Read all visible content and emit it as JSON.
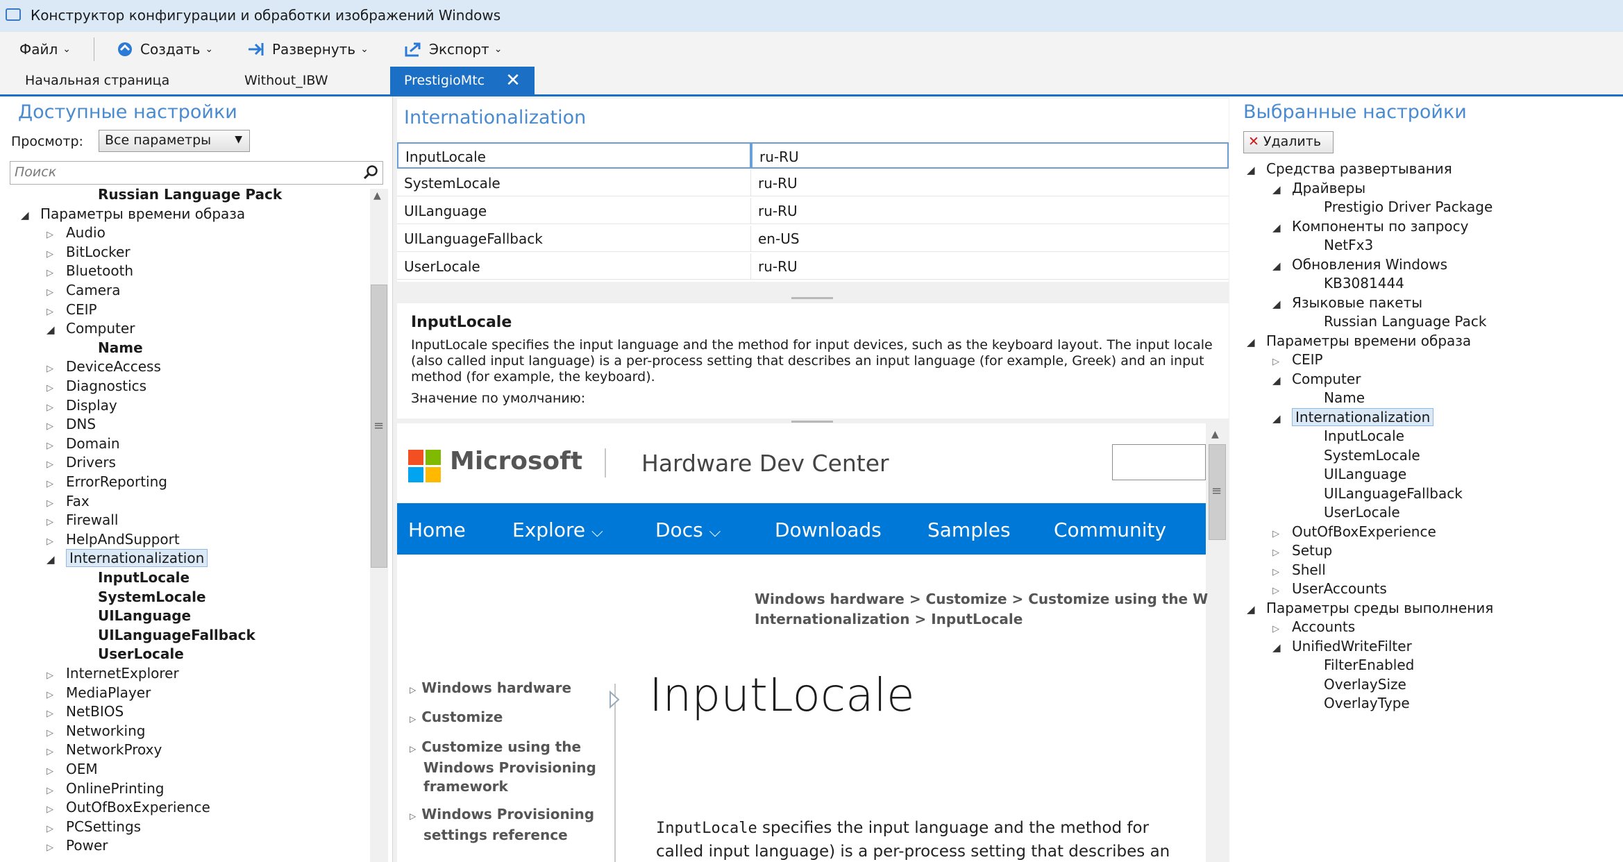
{
  "window": {
    "title": "Конструктор конфигурации и обработки изображений Windows"
  },
  "menu": {
    "file": "Файл",
    "create": "Создать",
    "deploy": "Развернуть",
    "export": "Экспорт"
  },
  "tabs": [
    {
      "label": "Начальная страница"
    },
    {
      "label": "Without_IBW"
    },
    {
      "label": "PrestigioMtc",
      "close": "✕"
    }
  ],
  "left": {
    "title": "Доступные настройки",
    "view_label": "Просмотр:",
    "view_value": "Все параметры",
    "search_placeholder": "Поиск",
    "tree": [
      {
        "text": "Russian Language Pack",
        "level": 3,
        "bold": true
      },
      {
        "text": "Параметры времени образа",
        "level": 0,
        "expander": "open"
      },
      {
        "text": "Audio",
        "level": 1,
        "expander": "closed"
      },
      {
        "text": "BitLocker",
        "level": 1,
        "expander": "closed"
      },
      {
        "text": "Bluetooth",
        "level": 1,
        "expander": "closed"
      },
      {
        "text": "Camera",
        "level": 1,
        "expander": "closed"
      },
      {
        "text": "CEIP",
        "level": 1,
        "expander": "closed"
      },
      {
        "text": "Computer",
        "level": 1,
        "expander": "open"
      },
      {
        "text": "Name",
        "level": 3,
        "bold": true
      },
      {
        "text": "DeviceAccess",
        "level": 1,
        "expander": "closed"
      },
      {
        "text": "Diagnostics",
        "level": 1,
        "expander": "closed"
      },
      {
        "text": "Display",
        "level": 1,
        "expander": "closed"
      },
      {
        "text": "DNS",
        "level": 1,
        "expander": "closed"
      },
      {
        "text": "Domain",
        "level": 1,
        "expander": "closed"
      },
      {
        "text": "Drivers",
        "level": 1,
        "expander": "closed"
      },
      {
        "text": "ErrorReporting",
        "level": 1,
        "expander": "closed"
      },
      {
        "text": "Fax",
        "level": 1,
        "expander": "closed"
      },
      {
        "text": "Firewall",
        "level": 1,
        "expander": "closed"
      },
      {
        "text": "HelpAndSupport",
        "level": 1,
        "expander": "closed"
      },
      {
        "text": "Internationalization",
        "level": 1,
        "expander": "open",
        "selected": true
      },
      {
        "text": "InputLocale",
        "level": 3,
        "bold": true
      },
      {
        "text": "SystemLocale",
        "level": 3,
        "bold": true
      },
      {
        "text": "UILanguage",
        "level": 3,
        "bold": true
      },
      {
        "text": "UILanguageFallback",
        "level": 3,
        "bold": true
      },
      {
        "text": "UserLocale",
        "level": 3,
        "bold": true
      },
      {
        "text": "InternetExplorer",
        "level": 1,
        "expander": "closed"
      },
      {
        "text": "MediaPlayer",
        "level": 1,
        "expander": "closed"
      },
      {
        "text": "NetBIOS",
        "level": 1,
        "expander": "closed"
      },
      {
        "text": "Networking",
        "level": 1,
        "expander": "closed"
      },
      {
        "text": "NetworkProxy",
        "level": 1,
        "expander": "closed"
      },
      {
        "text": "OEM",
        "level": 1,
        "expander": "closed"
      },
      {
        "text": "OnlinePrinting",
        "level": 1,
        "expander": "closed"
      },
      {
        "text": "OutOfBoxExperience",
        "level": 1,
        "expander": "closed"
      },
      {
        "text": "PCSettings",
        "level": 1,
        "expander": "closed"
      },
      {
        "text": "Power",
        "level": 1,
        "expander": "closed"
      }
    ]
  },
  "center": {
    "section_title": "Internationalization",
    "grid": [
      {
        "name": "InputLocale",
        "value": "ru-RU"
      },
      {
        "name": "SystemLocale",
        "value": "ru-RU"
      },
      {
        "name": "UILanguage",
        "value": "ru-RU"
      },
      {
        "name": "UILanguageFallback",
        "value": "en-US"
      },
      {
        "name": "UserLocale",
        "value": "ru-RU"
      }
    ],
    "desc_title": "InputLocale",
    "desc_text": "InputLocale specifies the input language and the method for input devices, such as the keyboard layout. The input locale (also called input language) is a per-process setting that describes an input language (for example, Greek) and an input method (for example, the keyboard).",
    "desc_default": "Значение по умолчанию:"
  },
  "browser": {
    "brand": "Microsoft",
    "site": "Hardware Dev Center",
    "nav": [
      "Home",
      "Explore",
      "Docs",
      "Downloads",
      "Samples",
      "Community"
    ],
    "crumbs_line1": "Windows hardware > Customize > Customize using the Win",
    "crumbs_line2": "Internationalization > InputLocale",
    "leftnav": [
      {
        "lines": [
          "Windows hardware"
        ]
      },
      {
        "lines": [
          "Customize"
        ]
      },
      {
        "lines": [
          "Customize using the",
          "Windows Provisioning",
          "framework"
        ]
      },
      {
        "lines": [
          "Windows Provisioning",
          "settings reference"
        ]
      }
    ],
    "heading": "InputLocale",
    "body_code": "InputLocale",
    "body_line1": " specifies the input language and the method for",
    "body_line2": "called input language) is a per-process setting that describes an"
  },
  "right": {
    "title": "Выбранные настройки",
    "delete_label": "Удалить",
    "tree": [
      {
        "text": "Средства развертывания",
        "level": 0,
        "expander": "open"
      },
      {
        "text": "Драйверы",
        "level": 1,
        "expander": "open"
      },
      {
        "text": "Prestigio Driver Package",
        "level": 3
      },
      {
        "text": "Компоненты по запросу",
        "level": 1,
        "expander": "open"
      },
      {
        "text": "NetFx3",
        "level": 3
      },
      {
        "text": "Обновления Windows",
        "level": 1,
        "expander": "open"
      },
      {
        "text": "KB3081444",
        "level": 3
      },
      {
        "text": "Языковые пакеты",
        "level": 1,
        "expander": "open"
      },
      {
        "text": "Russian Language Pack",
        "level": 3
      },
      {
        "text": "Параметры времени образа",
        "level": 0,
        "expander": "open"
      },
      {
        "text": "CEIP",
        "level": 1,
        "expander": "closed"
      },
      {
        "text": "Computer",
        "level": 1,
        "expander": "open"
      },
      {
        "text": "Name",
        "level": 3
      },
      {
        "text": "Internationalization",
        "level": 1,
        "expander": "open",
        "selected": true
      },
      {
        "text": "InputLocale",
        "level": 3
      },
      {
        "text": "SystemLocale",
        "level": 3
      },
      {
        "text": "UILanguage",
        "level": 3
      },
      {
        "text": "UILanguageFallback",
        "level": 3
      },
      {
        "text": "UserLocale",
        "level": 3
      },
      {
        "text": "OutOfBoxExperience",
        "level": 1,
        "expander": "closed"
      },
      {
        "text": "Setup",
        "level": 1,
        "expander": "closed"
      },
      {
        "text": "Shell",
        "level": 1,
        "expander": "closed"
      },
      {
        "text": "UserAccounts",
        "level": 1,
        "expander": "closed"
      },
      {
        "text": "Параметры среды выполнения",
        "level": 0,
        "expander": "open"
      },
      {
        "text": "Accounts",
        "level": 1,
        "expander": "closed"
      },
      {
        "text": "UnifiedWriteFilter",
        "level": 1,
        "expander": "open"
      },
      {
        "text": "FilterEnabled",
        "level": 3
      },
      {
        "text": "OverlaySize",
        "level": 3
      },
      {
        "text": "OverlayType",
        "level": 3
      }
    ]
  },
  "colors": {
    "accent": "#1b6fc4",
    "nav_bg": "#0078d7",
    "pane_title": "#4a8bd0",
    "selection": "#dbe9f7"
  }
}
